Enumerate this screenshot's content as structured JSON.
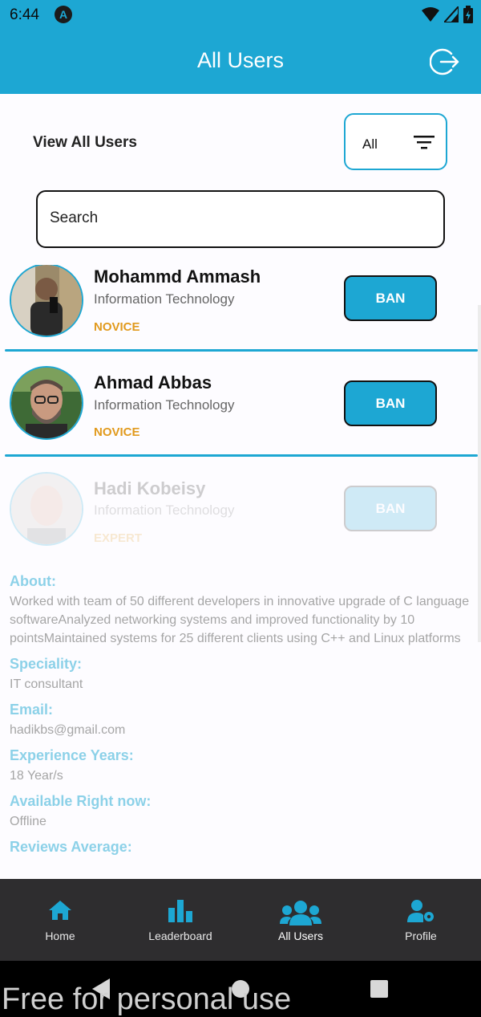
{
  "status_bar": {
    "time": "6:44",
    "app_badge": "A"
  },
  "header": {
    "title": "All Users"
  },
  "filter": {
    "label": "View All Users",
    "selected": "All"
  },
  "search": {
    "placeholder": "Search"
  },
  "users": [
    {
      "name": "Mohammd Ammash",
      "department": "Information Technology",
      "level": "NOVICE",
      "action": "BAN"
    },
    {
      "name": "Ahmad Abbas",
      "department": "Information Technology",
      "level": "NOVICE",
      "action": "BAN"
    },
    {
      "name": "Hadi Kobeisy",
      "department": "Information Technology",
      "level": "EXPERT",
      "action": "BAN"
    }
  ],
  "details": {
    "about_label": "About:",
    "about_value": "Worked with team of 50 different developers in innovative upgrade of C language softwareAnalyzed networking systems and improved functionality by 10 pointsMaintained systems for 25 different clients using C++ and Linux platforms",
    "speciality_label": "Speciality:",
    "speciality_value": "IT consultant",
    "email_label": "Email:",
    "email_value": "hadikbs@gmail.com",
    "experience_label": "Experience Years:",
    "experience_value": "18 Year/s",
    "available_label": "Available Right now:",
    "available_value": "Offline",
    "reviews_label": "Reviews Average:"
  },
  "bottom_nav": {
    "items": [
      {
        "label": "Home",
        "icon": "home-icon"
      },
      {
        "label": "Leaderboard",
        "icon": "bar-chart-icon"
      },
      {
        "label": "All Users",
        "icon": "users-icon",
        "active": true
      },
      {
        "label": "Profile",
        "icon": "user-settings-icon"
      }
    ]
  },
  "watermark": "Free for personal use",
  "colors": {
    "primary": "#1da7d3",
    "level": "#e19a1d",
    "nav_bg": "#2e2d2f"
  }
}
